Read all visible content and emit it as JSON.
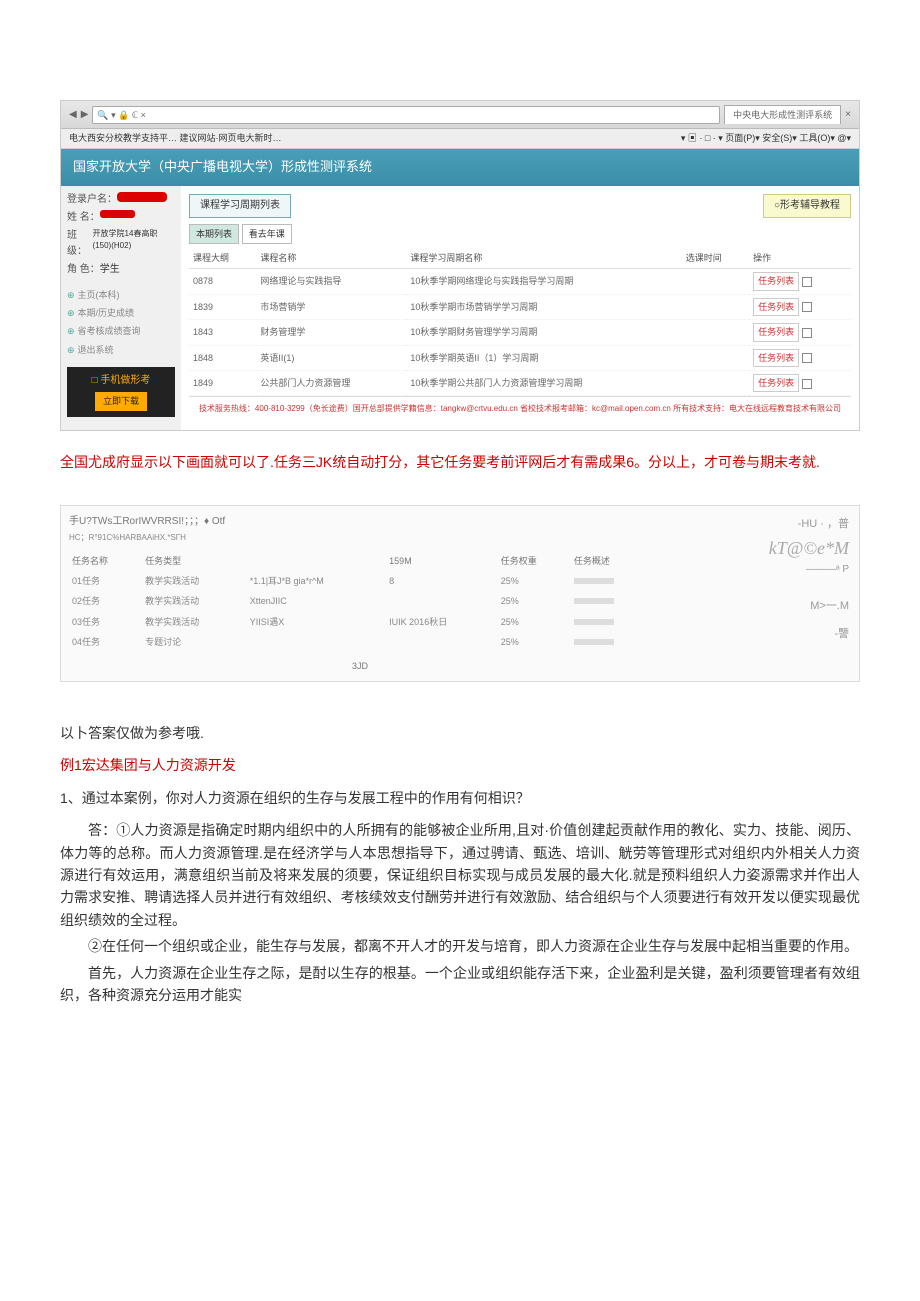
{
  "screenshot1": {
    "browser": {
      "tab_title": "中央电大形成性测评系统",
      "fav_text": "电大西安分校教学支持平… 建议网站·网页电大新时…",
      "right_menu": "▾ ▣ · □ · ▾ 页面(P)▾ 安全(S)▾ 工具(O)▾ @▾"
    },
    "banner": "国家开放大学（中央广播电视大学）形成性测评系统",
    "sidebar": {
      "user_label": "登录户名：",
      "name_label": "姓 名：",
      "class_label": "班 级：",
      "class_value": "开放学院14春高职\n(150)(H02)",
      "role_label": "角 色：",
      "role_value": "学生",
      "nav": [
        "主页(本科)",
        "本期/历史成绩",
        "省考核成绩查询",
        "退出系统"
      ],
      "promo_title": "□ 手机做形考",
      "promo_btn": "立即下载"
    },
    "tabs": {
      "left": "课程学习周期列表",
      "right": "○形考辅导教程"
    },
    "sub_tabs": [
      "本期列表",
      "看去年课"
    ],
    "table": {
      "headers": [
        "课程大纲",
        "课程名称",
        "课程学习周期名称",
        "选课时间",
        "操作"
      ],
      "rows": [
        {
          "code": "0878",
          "name": "网络理论与实践指导",
          "period": "10秋季学期网络理论与实践指导学习周期",
          "action": "任务列表"
        },
        {
          "code": "1839",
          "name": "市场营销学",
          "period": "10秋季学期市场营销学学习周期",
          "action": "任务列表"
        },
        {
          "code": "1843",
          "name": "财务管理学",
          "period": "10秋季学期财务管理学学习周期",
          "action": "任务列表"
        },
        {
          "code": "1848",
          "name": "英语II(1)",
          "period": "10秋季学期英语II（1）学习周期",
          "action": "任务列表"
        },
        {
          "code": "1849",
          "name": "公共部门人力资源管理",
          "period": "10秋季学期公共部门人力资源管理学习周期",
          "action": "任务列表"
        }
      ]
    },
    "footer": "技术服务热线：400-810-3299（免长途费）国开总部提供学籍信息：tangkw@crtvu.edu.cn 省校技术报考邮箱：kc@mail.open.com.cn\n所有技术支持：电大在线远程教育技术有限公司"
  },
  "red_caption": "全国尤成府显示以下画面就可以了.任务三JK统自动打分，其它任务要考前评网后才有需成果6。分以上，才可卷与期末考就.",
  "screenshot2": {
    "header": "手U?TWs工RorIWVRRSI!；；；♦          Otf",
    "sub_header": "HC；R°91C%HARBAAiHX.*SΓH",
    "table": {
      "headers": [
        "任务名称",
        "任务类型",
        "",
        "159M",
        "任务权重",
        "任务概述"
      ],
      "rows": [
        {
          "name": "01任务",
          "type": "教学实践活动",
          "mid": "*1.1|耳J*B gia*r^M",
          "date": "8",
          "weight": "25%"
        },
        {
          "name": "02任务",
          "type": "教学实践活动",
          "mid": "XttenJIIC",
          "date": "",
          "weight": "25%"
        },
        {
          "name": "03任务",
          "type": "教学实践活动",
          "mid": "YIISI遇X",
          "date": "IUIK 2016秋日",
          "weight": "25%"
        },
        {
          "name": "04任务",
          "type": "专题讨论",
          "mid": "",
          "date": "",
          "weight": "25%"
        }
      ],
      "bottom": "3JD"
    },
    "right": {
      "line1": "-HU · ，普",
      "decor": "kT@©e*M",
      "decor2": "———ᵃ P",
      "line3": "M>一.M",
      "line4": "-譼"
    }
  },
  "body": {
    "intro": "以卜答案仅做为参考哦.",
    "case_title": "例1宏达集团与人力资源开发",
    "q1": "1、通过本案例，你对人力资源在组织的生存与发展工程中的作用有何相识？",
    "p1": "答：①人力资源是指确定时期内组织中的人所拥有的能够被企业所用,且对·价值创建起贡献作用的教化、实力、技能、阅历、体力等的总称。而人力资源管理.是在经济学与人本思想指导下，通过骋请、甄选、培训、觥劳等管理形式对组织内外相关人力资源进行有效运用，满意组织当前及将来发展的须要，保证组织目标实现与成员发展的最大化.就是预料组织人力姿源需求并作出人力需求安推、聘请选择人员并进行有效组织、考核续效支付酬劳并进行有效激励、结合组织与个人须要进行有效开发以便实现最优组织绩效的全过程。",
    "p2": "②在任何一个组织或企业，能生存与发展，都离不开人才的开发与培育，即人力资源在企业生存与发展中起相当重要的作用。",
    "p3": "首先，人力资源在企业生存之际，是酎以生存的根基。一个企业或组织能存活下来，企业盈利是关键，盈利须要管理者有效组织，各种资源充分运用才能实"
  }
}
